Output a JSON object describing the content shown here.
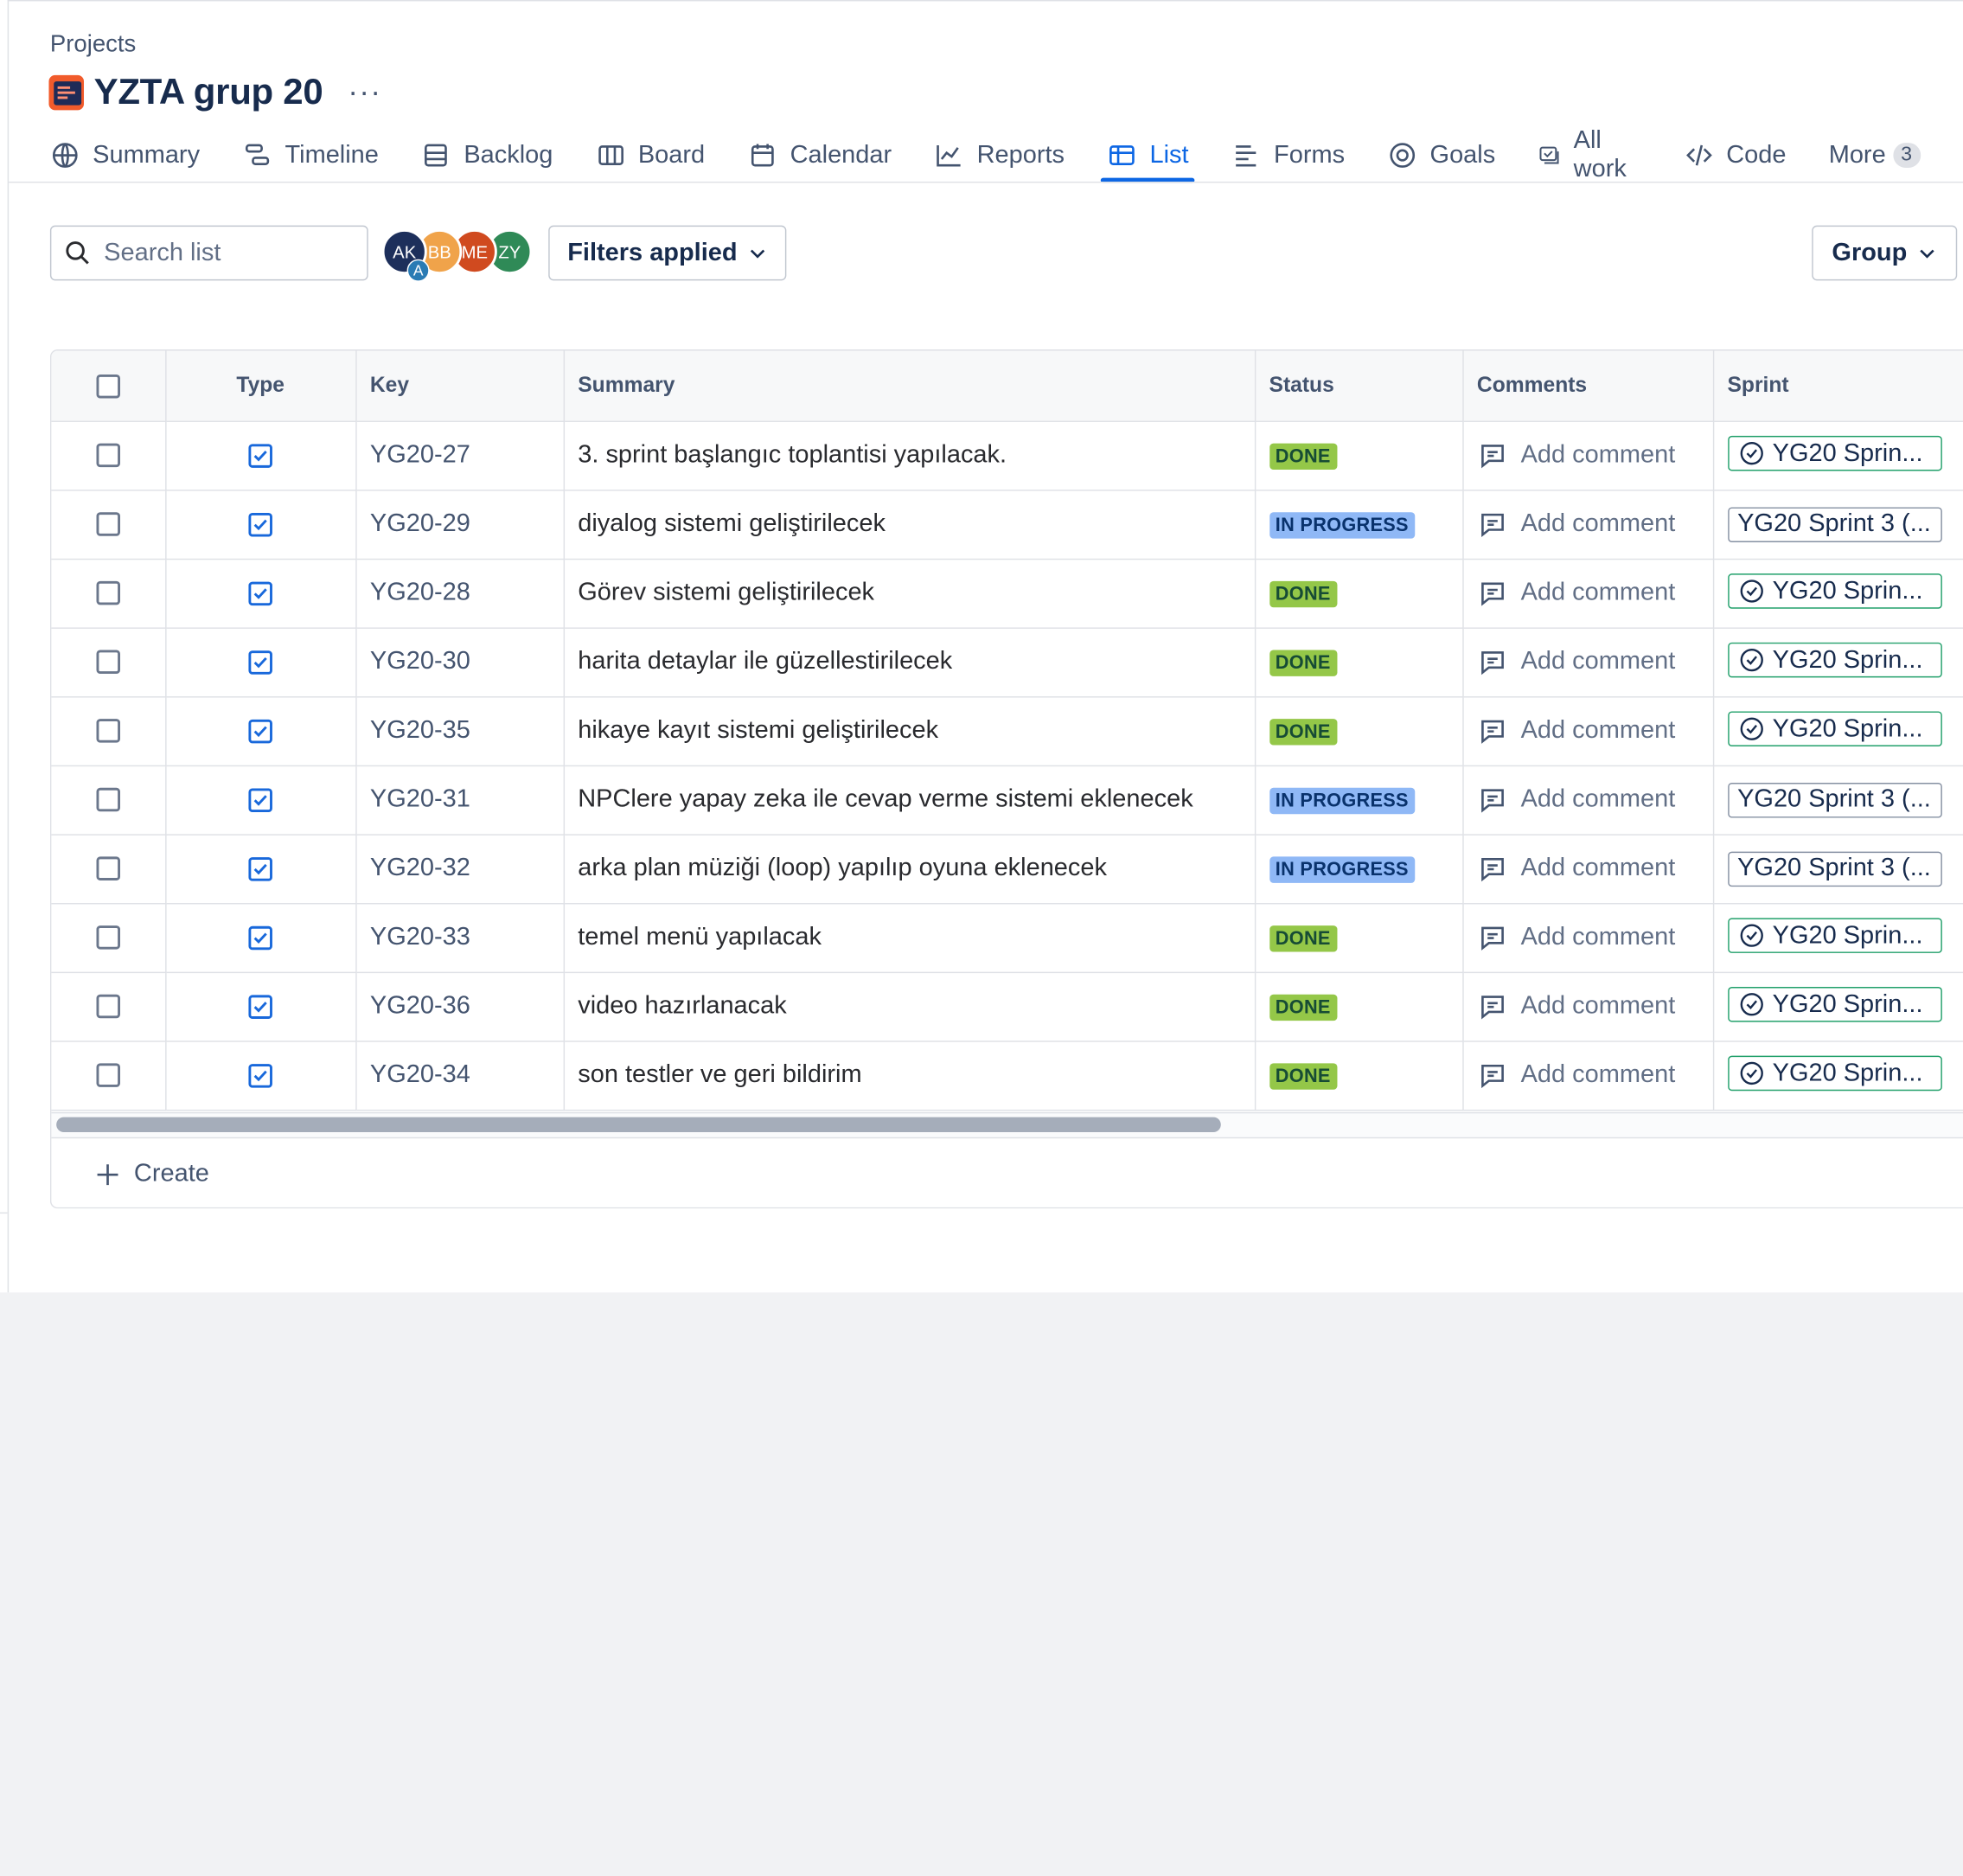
{
  "breadcrumb": "Projects",
  "project": {
    "title": "YZTA grup 20",
    "more": "···"
  },
  "tabs": [
    {
      "label": "Summary",
      "icon": "globe-icon"
    },
    {
      "label": "Timeline",
      "icon": "timeline-icon"
    },
    {
      "label": "Backlog",
      "icon": "backlog-icon"
    },
    {
      "label": "Board",
      "icon": "board-icon"
    },
    {
      "label": "Calendar",
      "icon": "calendar-icon"
    },
    {
      "label": "Reports",
      "icon": "chart-line-icon"
    },
    {
      "label": "List",
      "icon": "list-table-icon",
      "active": true
    },
    {
      "label": "Forms",
      "icon": "forms-icon"
    },
    {
      "label": "Goals",
      "icon": "goal-target-icon"
    },
    {
      "label": "All work",
      "icon": "all-work-icon"
    },
    {
      "label": "Code",
      "icon": "code-icon"
    },
    {
      "label": "More",
      "count": "3"
    }
  ],
  "toolbar": {
    "search_placeholder": "Search list",
    "filters_label": "Filters applied",
    "group_label": "Group",
    "avatars": [
      {
        "initials": "AK",
        "color": "#1d2f5b",
        "badge": "A"
      },
      {
        "initials": "BB",
        "color": "#f0a34a"
      },
      {
        "initials": "ME",
        "color": "#d04a1f"
      },
      {
        "initials": "ZY",
        "color": "#2f8a57"
      }
    ]
  },
  "table": {
    "columns": [
      "Type",
      "Key",
      "Summary",
      "Status",
      "Comments",
      "Sprint"
    ],
    "add_comment_label": "Add comment",
    "rows": [
      {
        "key": "YG20-27",
        "summary": "3. sprint başlangıc toplantisi yapılacak.",
        "status": "DONE",
        "status_kind": "done",
        "sprint": "YG20 Sprin...",
        "sprint_done": true
      },
      {
        "key": "YG20-29",
        "summary": "diyalog sistemi geliştirilecek",
        "status": "IN PROGRESS",
        "status_kind": "progress",
        "sprint": "YG20 Sprint 3 (...",
        "sprint_done": false
      },
      {
        "key": "YG20-28",
        "summary": "Görev sistemi geliştirilecek",
        "status": "DONE",
        "status_kind": "done",
        "sprint": "YG20 Sprin...",
        "sprint_done": true
      },
      {
        "key": "YG20-30",
        "summary": "harita detaylar ile güzellestirilecek",
        "status": "DONE",
        "status_kind": "done",
        "sprint": "YG20 Sprin...",
        "sprint_done": true
      },
      {
        "key": "YG20-35",
        "summary": "hikaye kayıt sistemi geliştirilecek",
        "status": "DONE",
        "status_kind": "done",
        "sprint": "YG20 Sprin...",
        "sprint_done": true
      },
      {
        "key": "YG20-31",
        "summary": "NPClere yapay zeka ile cevap verme sistemi eklenecek",
        "status": "IN PROGRESS",
        "status_kind": "progress",
        "sprint": "YG20 Sprint 3 (...",
        "sprint_done": false
      },
      {
        "key": "YG20-32",
        "summary": "arka plan müziği (loop) yapılıp oyuna eklenecek",
        "status": "IN PROGRESS",
        "status_kind": "progress",
        "sprint": "YG20 Sprint 3 (...",
        "sprint_done": false
      },
      {
        "key": "YG20-33",
        "summary": "temel menü yapılacak",
        "status": "DONE",
        "status_kind": "done",
        "sprint": "YG20 Sprin...",
        "sprint_done": true
      },
      {
        "key": "YG20-36",
        "summary": "video hazırlanacak",
        "status": "DONE",
        "status_kind": "done",
        "sprint": "YG20 Sprin...",
        "sprint_done": true
      },
      {
        "key": "YG20-34",
        "summary": "son testler ve geri bildirim",
        "status": "DONE",
        "status_kind": "done",
        "sprint": "YG20 Sprin...",
        "sprint_done": true
      }
    ]
  },
  "create_label": "Create"
}
